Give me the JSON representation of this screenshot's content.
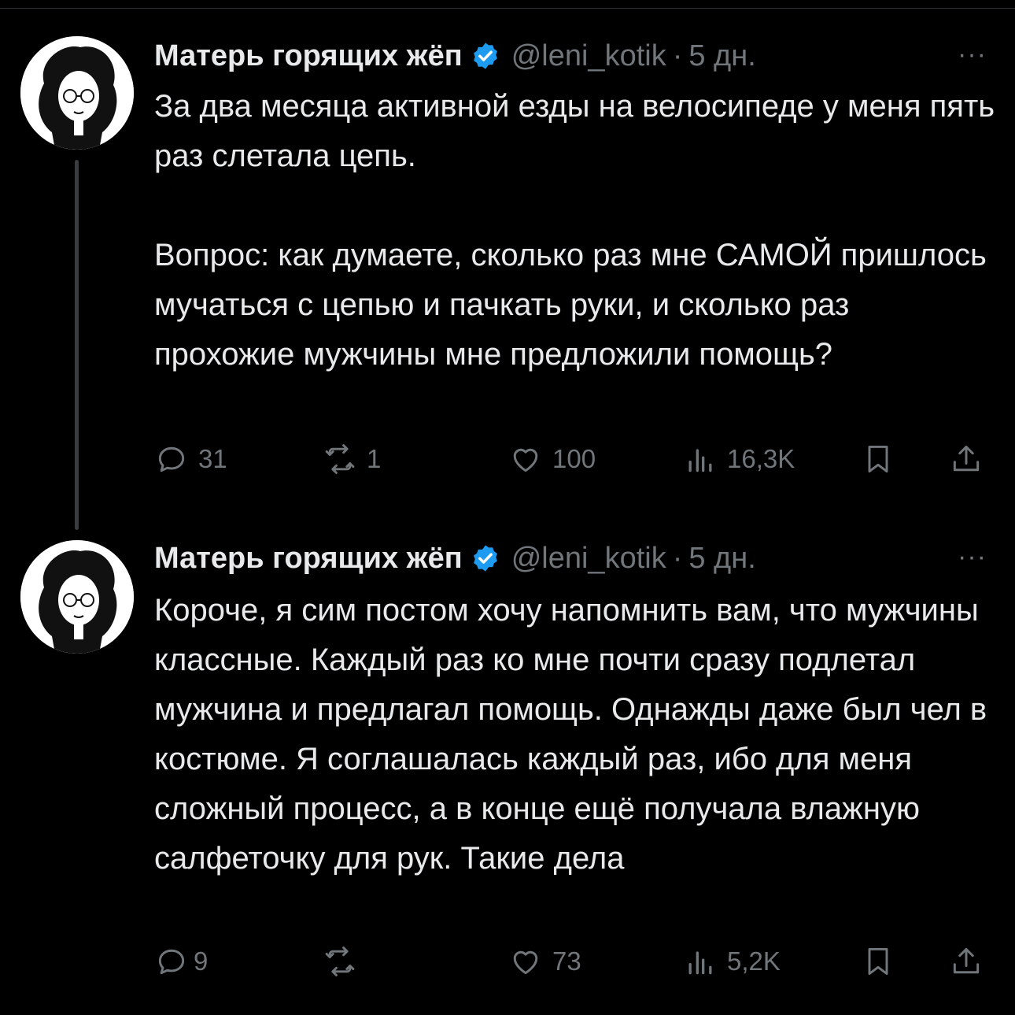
{
  "tweets": [
    {
      "author": "Матерь горящих жёп",
      "handle": "@leni_kotik",
      "separator": "·",
      "time": "5 дн.",
      "more_label": "···",
      "text": "За два месяца активной езды на велосипеде у меня пять раз слетала цепь.\n\nВопрос: как думаете, сколько раз мне САМОЙ пришлось мучаться с цепью и пачкать руки, и сколько раз прохожие мужчины мне предложили помощь?",
      "replies": "31",
      "reposts": "1",
      "likes": "100",
      "views": "16,3K"
    },
    {
      "author": "Матерь горящих жёп",
      "handle": "@leni_kotik",
      "separator": "·",
      "time": "5 дн.",
      "more_label": "···",
      "text": "Короче, я сим постом хочу напомнить вам, что мужчины классные. Каждый раз ко мне почти сразу подлетал мужчина и предлагал помощь. Однажды даже был чел в костюме. Я соглашалась каждый раз, ибо для меня сложный процесс, а в конце ещё получала влажную салфеточку для рук. Такие дела",
      "replies": "9",
      "reposts": "",
      "likes": "73",
      "views": "5,2K"
    }
  ],
  "icons": {
    "reply": "reply-icon",
    "repost": "repost-icon",
    "like": "heart-icon",
    "views": "views-icon",
    "bookmark": "bookmark-icon",
    "share": "share-icon",
    "verified": "verified-badge-icon"
  },
  "colors": {
    "background": "#000000",
    "text": "#e7e9ea",
    "muted": "#71767b",
    "verified": "#1d9bf0"
  }
}
